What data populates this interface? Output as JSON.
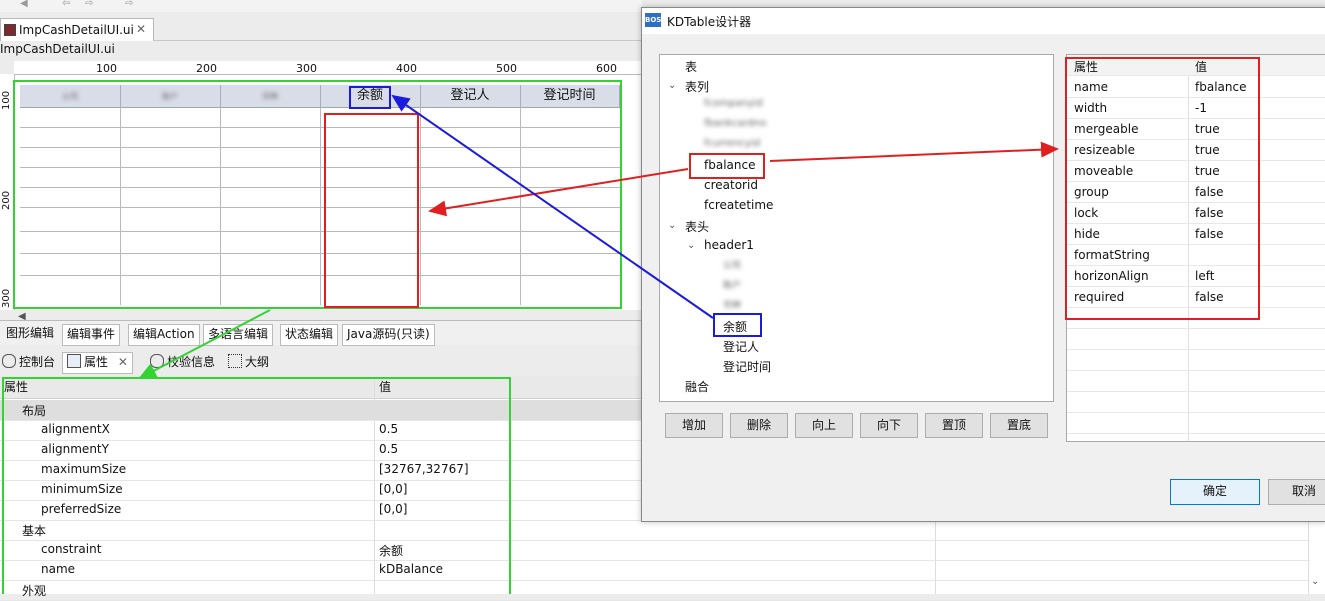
{
  "editor": {
    "tab_title": "ImpCashDetailUI.ui",
    "file_label": "ImpCashDetailUI.ui",
    "ruler_top": [
      "100",
      "200",
      "300",
      "400",
      "500",
      "600"
    ],
    "ruler_left": [
      "100",
      "200",
      "300"
    ]
  },
  "grid": {
    "headers_blurred": [
      "公司",
      "账户",
      "币种"
    ],
    "headers": [
      "余额",
      "登记人",
      "登记时间"
    ]
  },
  "bottom_tabs": [
    "图形编辑",
    "编辑事件",
    "编辑Action",
    "多语言编辑",
    "状态编辑",
    "Java源码(只读)"
  ],
  "props_tabs": [
    "控制台",
    "属性",
    "校验信息",
    "大纲"
  ],
  "prop_table": {
    "col_key": "属性",
    "col_value": "值",
    "rows": [
      {
        "key": "布局",
        "value": "",
        "group": true
      },
      {
        "key": "alignmentX",
        "value": "0.5"
      },
      {
        "key": "alignmentY",
        "value": "0.5"
      },
      {
        "key": "maximumSize",
        "value": "[32767,32767]"
      },
      {
        "key": "minimumSize",
        "value": "[0,0]"
      },
      {
        "key": "preferredSize",
        "value": "[0,0]"
      },
      {
        "key": "基本",
        "value": "",
        "group": true
      },
      {
        "key": "constraint",
        "value": "余额"
      },
      {
        "key": "name",
        "value": "kDBalance"
      },
      {
        "key": "外观",
        "value": "",
        "group": true
      }
    ]
  },
  "dialog": {
    "title": "KDTable设计器",
    "logo": "BOS",
    "tree": {
      "root": "表",
      "columns_label": "表列",
      "columns_blurred": [
        "fcompanyid",
        "fbankcardno",
        "fcurrencyid"
      ],
      "columns": [
        "fbalance",
        "creatorid",
        "fcreatetime"
      ],
      "header_label": "表头",
      "header1": "header1",
      "header1_blurred": [
        "公司",
        "账户",
        "币种"
      ],
      "header1_items": [
        "余额",
        "登记人",
        "登记时间"
      ],
      "merge_label": "融合"
    },
    "buttons": [
      "增加",
      "删除",
      "向上",
      "向下",
      "置顶",
      "置底"
    ],
    "attr": {
      "col_key": "属性",
      "col_value": "值",
      "rows": [
        {
          "key": "name",
          "value": "fbalance"
        },
        {
          "key": "width",
          "value": "-1"
        },
        {
          "key": "mergeable",
          "value": "true"
        },
        {
          "key": "resizeable",
          "value": "true"
        },
        {
          "key": "moveable",
          "value": "true"
        },
        {
          "key": "group",
          "value": "false"
        },
        {
          "key": "lock",
          "value": "false"
        },
        {
          "key": "hide",
          "value": "false"
        },
        {
          "key": "formatString",
          "value": ""
        },
        {
          "key": "horizonAlign",
          "value": "left"
        },
        {
          "key": "required",
          "value": "false"
        }
      ]
    },
    "ok": "确定",
    "cancel": "取消"
  },
  "colors": {
    "annot_red": "#e02020",
    "annot_blue": "#1a1ae0",
    "annot_green": "#34d334",
    "accent": "#0078d7"
  }
}
